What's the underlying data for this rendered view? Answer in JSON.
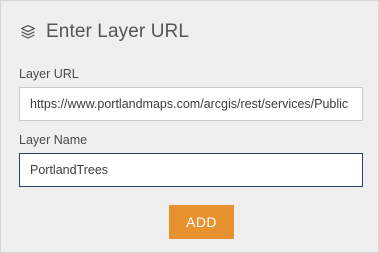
{
  "dialog": {
    "title": "Enter Layer URL",
    "icon": "layers-icon"
  },
  "layer_url": {
    "label": "Layer URL",
    "value": "https://www.portlandmaps.com/arcgis/rest/services/Public"
  },
  "layer_name": {
    "label": "Layer Name",
    "value": "PortlandTrees"
  },
  "actions": {
    "add_label": "ADD"
  },
  "colors": {
    "accent": "#e8912f",
    "panel_bg": "#efefef",
    "focus_border": "#2c3e5f"
  }
}
